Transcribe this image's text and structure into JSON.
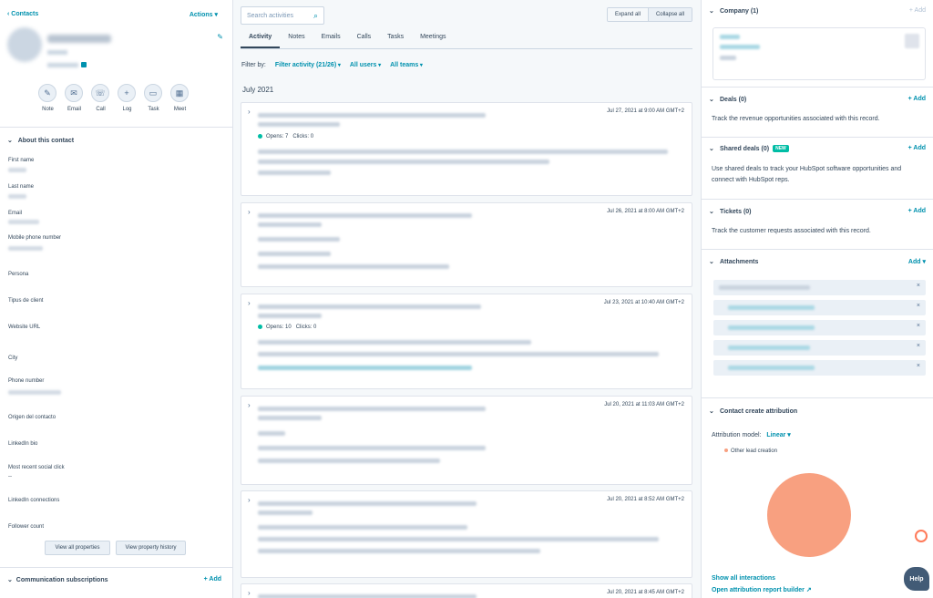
{
  "left": {
    "back_label": "Contacts",
    "actions_label": "Actions",
    "quick_actions": [
      {
        "label": "Note",
        "icon": "pencil-icon"
      },
      {
        "label": "Email",
        "icon": "envelope-icon"
      },
      {
        "label": "Call",
        "icon": "phone-icon"
      },
      {
        "label": "Log",
        "icon": "plus-icon"
      },
      {
        "label": "Task",
        "icon": "task-icon"
      },
      {
        "label": "Meet",
        "icon": "calendar-icon"
      }
    ],
    "about_title": "About this contact",
    "properties": [
      "First name",
      "Last name",
      "Email",
      "Mobile phone number",
      "Persona",
      "Tipus de client",
      "Website URL",
      "City",
      "Phone number",
      "Origen del contacto",
      "LinkedIn bio",
      "Most recent social click",
      "LinkedIn connections",
      "Follower count"
    ],
    "social_click_value": "--",
    "view_all_label": "View all properties",
    "view_history_label": "View property history",
    "comm_title": "Communication subscriptions",
    "comm_add": "+ Add"
  },
  "middle": {
    "search_placeholder": "Search activities",
    "expand_all": "Expand all",
    "collapse_all": "Collapse all",
    "tabs": [
      "Activity",
      "Notes",
      "Emails",
      "Calls",
      "Tasks",
      "Meetings"
    ],
    "filter_label": "Filter by:",
    "filter_activity": "Filter activity (21/26)",
    "filter_users": "All users",
    "filter_teams": "All teams",
    "month": "July 2021",
    "cards": [
      {
        "date": "Jul 27, 2021 at 9:00 AM GMT+2",
        "opens": "Opens: 7",
        "clicks": "Clicks: 0"
      },
      {
        "date": "Jul 26, 2021 at 8:00 AM GMT+2"
      },
      {
        "date": "Jul 23, 2021 at 10:40 AM GMT+2",
        "opens": "Opens: 10",
        "clicks": "Clicks: 0"
      },
      {
        "date": "Jul 20, 2021 at 11:03 AM GMT+2"
      },
      {
        "date": "Jul 20, 2021 at 8:52 AM GMT+2"
      },
      {
        "date": "Jul 20, 2021 at 8:45 AM GMT+2"
      }
    ]
  },
  "right": {
    "company_title": "Company (1)",
    "company_add": "+ Add",
    "deals_title": "Deals (0)",
    "deals_add": "+ Add",
    "deals_text": "Track the revenue opportunities associated with this record.",
    "shared_title": "Shared deals (0)",
    "shared_badge": "NEW",
    "shared_add": "+ Add",
    "shared_text": "Use shared deals to track your HubSpot software opportunities and connect with HubSpot reps.",
    "tickets_title": "Tickets (0)",
    "tickets_add": "+ Add",
    "tickets_text": "Track the customer requests associated with this record.",
    "attach_title": "Attachments",
    "attach_add": "Add",
    "attribution_title": "Contact create attribution",
    "attribution_model_label": "Attribution model:",
    "attribution_model_value": "Linear",
    "legend_label": "Other lead creation",
    "show_all": "Show all interactions",
    "open_report": "Open attribution report builder",
    "pie_color": "#f8a080"
  },
  "help_label": "Help"
}
